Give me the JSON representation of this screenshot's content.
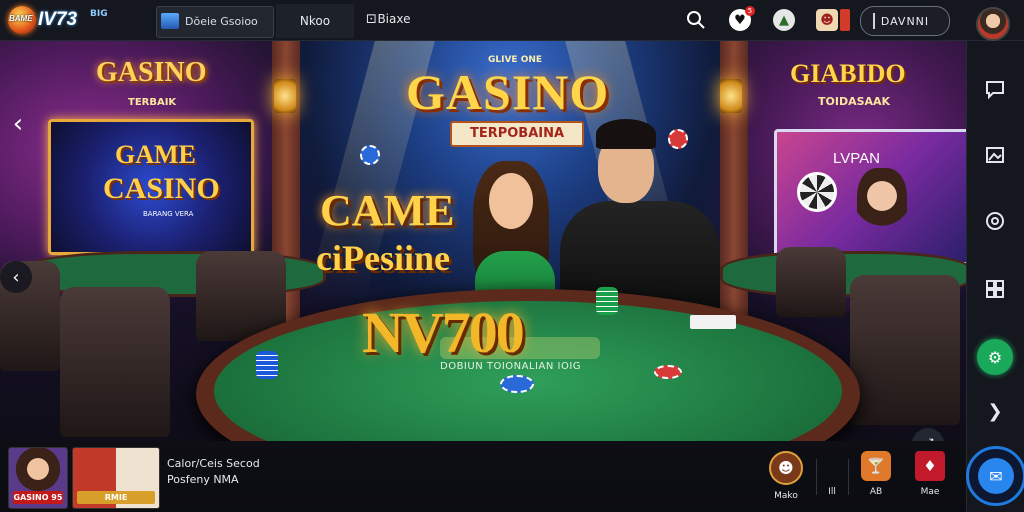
{
  "topbar": {
    "logo": {
      "badge_text": "BAME",
      "brand": "IV73",
      "suffix": "BIG"
    },
    "tabs": [
      {
        "label": "Dŏeie Gsoioo",
        "icon": "game-thumbnail-icon"
      },
      {
        "label": "Nkoo"
      },
      {
        "label": "Biaxe",
        "icon": "dice-icon"
      }
    ],
    "icons": {
      "search": "⌕",
      "notifications_badge": "5"
    },
    "login_label": "DAVNNI",
    "colors": {
      "accent_green": "#1aa85a",
      "chat_blue": "#2a86ef",
      "badge_red": "#e02424"
    }
  },
  "hero": {
    "sign_left": {
      "title": "GASINO",
      "sub": "TERBAIK"
    },
    "screen_left": {
      "line1": "GAME",
      "line2": "CASINO",
      "line3": "BARANG VERA"
    },
    "sign_center": {
      "small": "GLIVE ONE",
      "title": "GASINO",
      "sub": "TERPOBAINA"
    },
    "sign_right": {
      "title": "GIABIDO",
      "sub": "TOIDASAAK"
    },
    "screen_right": {
      "label": "LVPAN"
    },
    "overlay": {
      "line1": "CAME",
      "line2": "ciPesiine",
      "line3": "NV700",
      "tagline": "DOBIUN TOIONALIAN IOIG"
    }
  },
  "bottombar": {
    "thumbs": [
      {
        "label": "GASINO 95"
      },
      {
        "label": "RMIE"
      }
    ],
    "now_title": "Calor/Ceis Secod",
    "now_sub": "Posfeny NMA",
    "items": [
      {
        "label": "Mako",
        "icon": "player-avatar-icon"
      },
      {
        "label": "Ill",
        "icon": ""
      },
      {
        "label": "AB",
        "icon": "cocktail-icon"
      },
      {
        "label": "Mae",
        "icon": "card-icon"
      }
    ]
  },
  "sidebar": {
    "items": [
      "chat-bubble-icon",
      "image-icon",
      "wheel-icon",
      "grid-icon",
      "support-icon",
      "forward-icon"
    ]
  }
}
